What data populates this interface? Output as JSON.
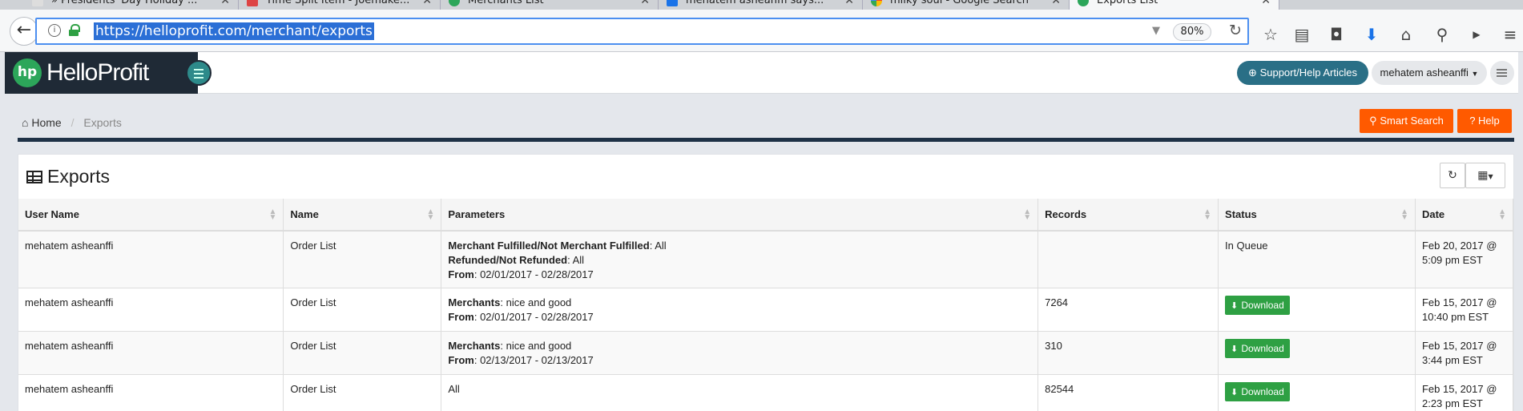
{
  "browser": {
    "tabs": [
      {
        "title": "» Presidents' Day Holiday ...",
        "active": false
      },
      {
        "title": "Time Split Item - Joemake...",
        "active": false
      },
      {
        "title": "Merchants List",
        "active": false
      },
      {
        "title": "mehatem asheanffi says...",
        "active": false
      },
      {
        "title": "milky soul - Google Search",
        "active": false
      },
      {
        "title": "Exports List",
        "active": true
      }
    ],
    "url": "https://helloprofit.com/merchant/exports",
    "zoom": "80%"
  },
  "app": {
    "brand_logo_text": "hp",
    "brand_name": "HelloProfit",
    "support_label": "Support/Help Articles",
    "user_label": "mehatem asheanffi"
  },
  "breadcrumb": {
    "home": "Home",
    "current": "Exports"
  },
  "actions": {
    "smart_search": "Smart Search",
    "help": "Help"
  },
  "panel": {
    "title": "Exports"
  },
  "table": {
    "columns": [
      "User Name",
      "Name",
      "Parameters",
      "Records",
      "Status",
      "Date"
    ],
    "rows": [
      {
        "user": "mehatem asheanffi",
        "name": "Order List",
        "params": [
          {
            "key": "Merchant Fulfilled/Not Merchant Fulfilled",
            "value": ": All"
          },
          {
            "key": "Refunded/Not Refunded",
            "value": ": All"
          },
          {
            "key": "From",
            "value": ": 02/01/2017 - 02/28/2017"
          }
        ],
        "records": "",
        "status": "In Queue",
        "date_line1": "Feb 20, 2017 @",
        "date_line2": "5:09 pm EST"
      },
      {
        "user": "mehatem asheanffi",
        "name": "Order List",
        "params": [
          {
            "key": "Merchants",
            "value": ": nice and good"
          },
          {
            "key": "From",
            "value": ": 02/01/2017 - 02/28/2017"
          }
        ],
        "records": "7264",
        "status": "Download",
        "date_line1": "Feb 15, 2017 @",
        "date_line2": "10:40 pm EST"
      },
      {
        "user": "mehatem asheanffi",
        "name": "Order List",
        "params": [
          {
            "key": "Merchants",
            "value": ": nice and good"
          },
          {
            "key": "From",
            "value": ": 02/13/2017 - 02/13/2017"
          }
        ],
        "records": "310",
        "status": "Download",
        "date_line1": "Feb 15, 2017 @",
        "date_line2": "3:44 pm EST"
      },
      {
        "user": "mehatem asheanffi",
        "name": "Order List",
        "params_text": "All",
        "records": "82544",
        "status": "Download",
        "date_line1": "Feb 15, 2017 @",
        "date_line2": "2:23 pm EST"
      }
    ]
  },
  "colors": {
    "brand_dark": "#1f2a36",
    "logo_green": "#2ca65a",
    "support_teal": "#2a6f86",
    "accent_orange": "#ff5a00",
    "download_green": "#2ea043",
    "url_highlight": "#2b6fd6"
  }
}
